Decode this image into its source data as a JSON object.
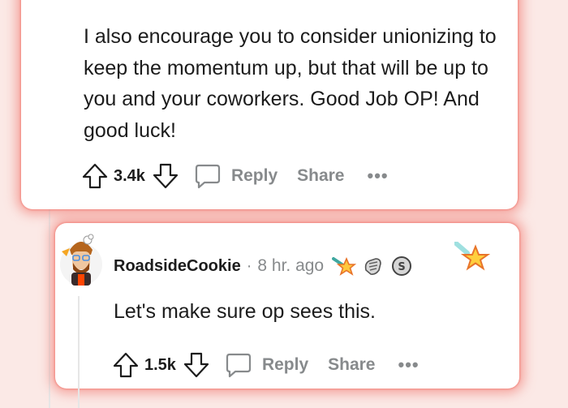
{
  "comment1": {
    "body": "I also encourage you to consider unionizing to keep the momentum up, but that will be up to you and your coworkers. Good Job OP! And good luck!",
    "score": "3.4k",
    "reply_label": "Reply",
    "share_label": "Share",
    "more_label": "•••"
  },
  "comment2": {
    "username": "RoadsideCookie",
    "separator": "·",
    "time": "8 hr. ago",
    "body": "Let's make sure op sees this.",
    "score": "1.5k",
    "reply_label": "Reply",
    "share_label": "Share",
    "more_label": "•••",
    "awards": [
      "rocket-star-award-icon",
      "hands-award-icon",
      "silver-award-icon",
      "star-award-icon"
    ]
  },
  "colors": {
    "highlight_glow": "#f06e64",
    "muted_text": "#878a8c",
    "text": "#1c1c1c"
  }
}
